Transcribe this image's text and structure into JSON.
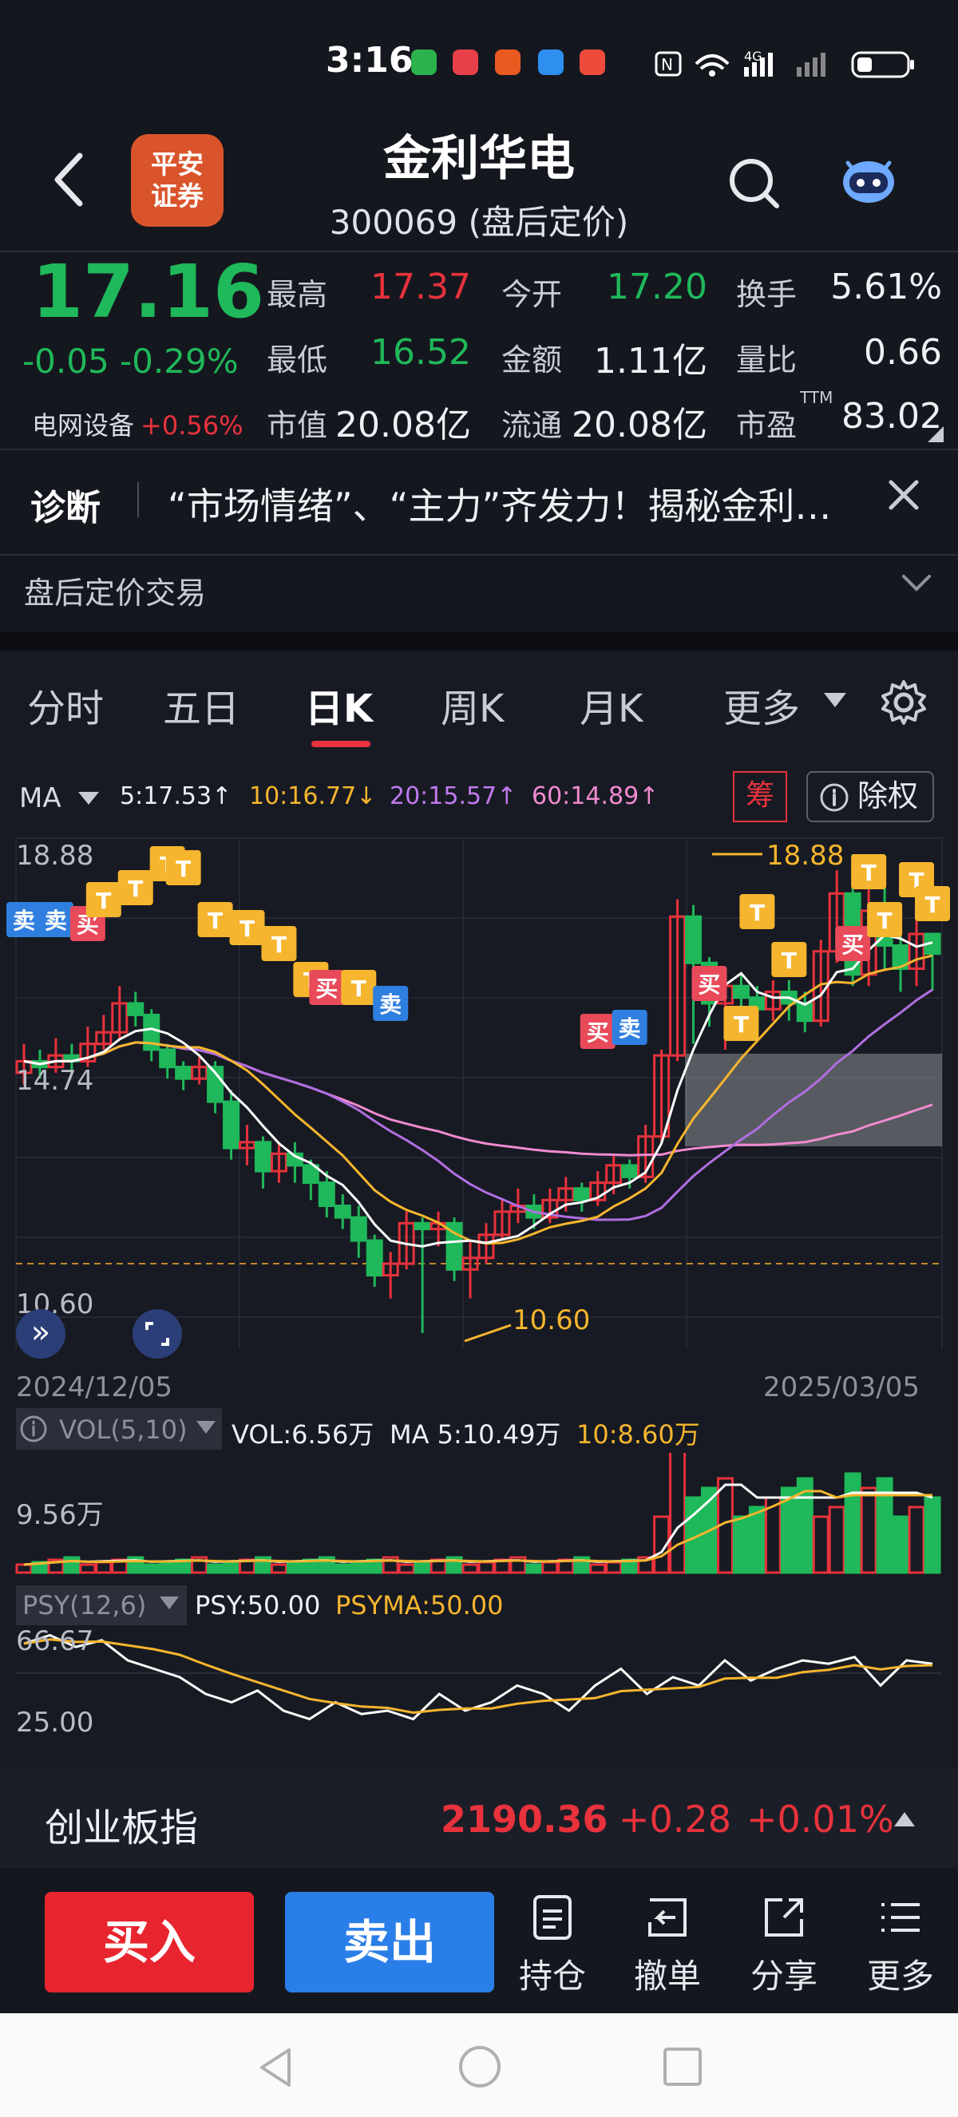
{
  "status": {
    "time": "3:16",
    "network": "4G"
  },
  "header": {
    "title": "金利华电",
    "subtitle": "300069 (盘后定价)",
    "logo_text": "平安\n证券",
    "logo_line1": "平安",
    "logo_line2": "证券"
  },
  "quote": {
    "price": "17.16",
    "change": "-0.05 -0.29%",
    "sector_name": "电网设备",
    "sector_pct": "+0.56%",
    "high_label": "最高",
    "high": "17.37",
    "open_label": "今开",
    "open": "17.20",
    "turnover_label": "换手",
    "turnover": "5.61%",
    "low_label": "最低",
    "low": "16.52",
    "amount_label": "金额",
    "amount": "1.11亿",
    "volratio_label": "量比",
    "volratio": "0.66",
    "mcap_label": "市值",
    "mcap": "20.08亿",
    "float_label": "流通",
    "float": "20.08亿",
    "pe_label": "市盈",
    "pe_sup": "TTM",
    "pe": "83.02"
  },
  "diagnosis": {
    "label": "诊断",
    "text": "“市场情绪”、“主力”齐发力！揭秘金利…"
  },
  "after_hours": {
    "label": "盘后定价交易"
  },
  "tabs": [
    "分时",
    "五日",
    "日K",
    "周K",
    "月K",
    "更多"
  ],
  "active_tab": "日K",
  "ma": {
    "label": "MA",
    "ma5": "5:17.53↑",
    "ma10": "10:16.77↓",
    "ma20": "20:15.57↑",
    "ma60": "60:14.89↑"
  },
  "chart_buttons": {
    "chip": "筹",
    "ex_rights": "除权"
  },
  "chart": {
    "y_high": "18.88",
    "y_mid": "14.74",
    "y_low": "10.60",
    "peak_label": "18.88",
    "trough_label": "10.60",
    "date_start": "2024/12/05",
    "date_end": "2025/03/05",
    "colors": {
      "up": "#e8323c",
      "down": "#1fb85a",
      "ma5": "#ffffff",
      "ma10": "#f5b52e",
      "ma20": "#b06ee0",
      "ma60": "#f08ad0"
    },
    "signals": {
      "buy": "买",
      "sell": "卖",
      "t": "T"
    }
  },
  "vol": {
    "label": "VOL(5,10)",
    "vol": "VOL:6.56万",
    "ma5": "MA 5:10.49万",
    "ma10": "10:8.60万",
    "axis": "9.56万"
  },
  "psy": {
    "label": "PSY(12,6)",
    "psy": "PSY:50.00",
    "psyma": "PSYMA:50.00",
    "axis_top": "66.67",
    "axis_bottom": "25.00"
  },
  "index": {
    "name": "创业板指",
    "value": "2190.36",
    "change": "+0.28",
    "pct": "+0.01%"
  },
  "trade": {
    "buy": "买入",
    "sell": "卖出",
    "position": "持仓",
    "cancel": "撤单",
    "share": "分享",
    "more": "更多"
  }
}
